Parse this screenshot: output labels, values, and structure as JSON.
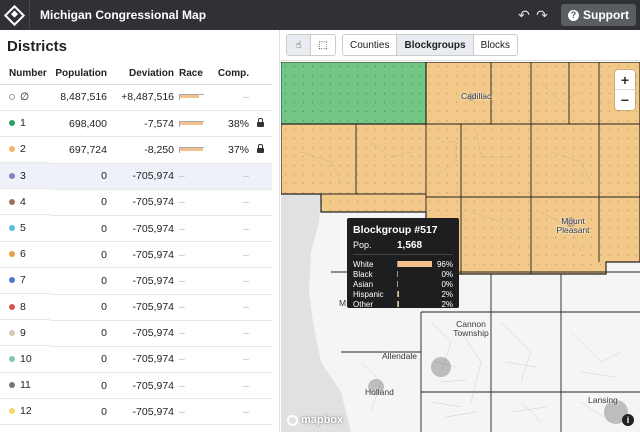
{
  "header": {
    "title": "Michigan Congressional Map",
    "undo_icon": "undo-icon",
    "redo_icon": "redo-icon",
    "support_label": "Support"
  },
  "sidebar": {
    "title": "Districts",
    "columns": [
      "Number",
      "Population",
      "Deviation",
      "Race",
      "Comp."
    ],
    "rows": [
      {
        "number": "∅",
        "color": "",
        "population": "8,487,516",
        "deviation": "+8,487,516",
        "race_white": 0.8,
        "comp": "–",
        "locked": false,
        "empty": true
      },
      {
        "number": "1",
        "color": "#2ca25f",
        "population": "698,400",
        "deviation": "-7,574",
        "race_white": 0.96,
        "comp": "38%",
        "locked": true
      },
      {
        "number": "2",
        "color": "#f2b46b",
        "population": "697,724",
        "deviation": "-8,250",
        "race_white": 0.95,
        "comp": "37%",
        "locked": true
      },
      {
        "number": "3",
        "color": "#8e7cc3",
        "population": "0",
        "deviation": "-705,974",
        "race_white": 0,
        "comp": "–",
        "locked": false,
        "selected": true
      },
      {
        "number": "4",
        "color": "#a0705a",
        "population": "0",
        "deviation": "-705,974",
        "race_white": 0,
        "comp": "–",
        "locked": false
      },
      {
        "number": "5",
        "color": "#5bc0de",
        "population": "0",
        "deviation": "-705,974",
        "race_white": 0,
        "comp": "–",
        "locked": false
      },
      {
        "number": "6",
        "color": "#e6a04a",
        "population": "0",
        "deviation": "-705,974",
        "race_white": 0,
        "comp": "–",
        "locked": false
      },
      {
        "number": "7",
        "color": "#4a78c8",
        "population": "0",
        "deviation": "-705,974",
        "race_white": 0,
        "comp": "–",
        "locked": false
      },
      {
        "number": "8",
        "color": "#d9534f",
        "population": "0",
        "deviation": "-705,974",
        "race_white": 0,
        "comp": "–",
        "locked": false
      },
      {
        "number": "9",
        "color": "#d8c8b0",
        "population": "0",
        "deviation": "-705,974",
        "race_white": 0,
        "comp": "–",
        "locked": false
      },
      {
        "number": "10",
        "color": "#7fc9a8",
        "population": "0",
        "deviation": "-705,974",
        "race_white": 0,
        "comp": "–",
        "locked": false
      },
      {
        "number": "11",
        "color": "#777777",
        "population": "0",
        "deviation": "-705,974",
        "race_white": 0,
        "comp": "–",
        "locked": false
      },
      {
        "number": "12",
        "color": "#f5d76e",
        "population": "0",
        "deviation": "-705,974",
        "race_white": 0,
        "comp": "–",
        "locked": false
      }
    ]
  },
  "toolbar": {
    "tools": [
      "pointer-icon",
      "rectangle-select-icon"
    ],
    "geo_levels": [
      "Counties",
      "Blockgroups",
      "Blocks"
    ],
    "active_level": "Blockgroups"
  },
  "map": {
    "zoom_in": "+",
    "zoom_out": "−",
    "places": [
      "Cadillac",
      "Mount Pleasant",
      "Cannon Township",
      "Allendale",
      "Holland",
      "Lansing",
      "M"
    ],
    "attribution": "mapbox",
    "info": "i",
    "colors": {
      "district1": "#74c687",
      "district2": "#f3c989",
      "unassigned": "#f3f3f3",
      "water": "#e2e2e2"
    }
  },
  "tooltip": {
    "title": "Blockgroup #517",
    "pop_label": "Pop.",
    "pop_value": "1,568",
    "rows": [
      {
        "label": "White",
        "pct": "96%",
        "value": 0.96
      },
      {
        "label": "Black",
        "pct": "0%",
        "value": 0
      },
      {
        "label": "Asian",
        "pct": "0%",
        "value": 0
      },
      {
        "label": "Hispanic",
        "pct": "2%",
        "value": 0.02
      },
      {
        "label": "Other",
        "pct": "2%",
        "value": 0.02
      }
    ]
  }
}
